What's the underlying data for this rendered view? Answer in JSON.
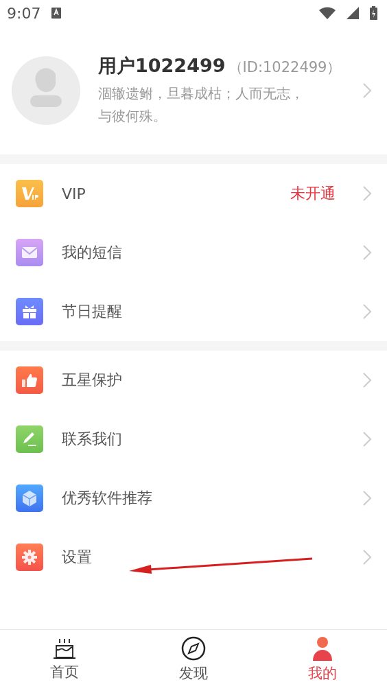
{
  "status_bar": {
    "time": "9:07"
  },
  "profile": {
    "name": "用户1022499",
    "id": "（ID:1022499）",
    "motto": "涸辙遗鲋，旦暮成枯；人而无志，与彼何殊。"
  },
  "menu_groups": [
    {
      "items": [
        {
          "kind": "vip",
          "label": "VIP",
          "value": "未开通"
        },
        {
          "kind": "mail",
          "label": "我的短信"
        },
        {
          "kind": "gift",
          "label": "节日提醒"
        }
      ]
    },
    {
      "items": [
        {
          "kind": "thumb",
          "label": "五星保护"
        },
        {
          "kind": "pencil",
          "label": "联系我们"
        },
        {
          "kind": "cube",
          "label": "优秀软件推荐"
        },
        {
          "kind": "gear",
          "label": "设置",
          "annotated": true
        }
      ]
    }
  ],
  "tabs": [
    {
      "kind": "cake",
      "label": "首页",
      "selected": false
    },
    {
      "kind": "compass",
      "label": "发现",
      "selected": false
    },
    {
      "kind": "person",
      "label": "我的",
      "selected": true
    }
  ]
}
